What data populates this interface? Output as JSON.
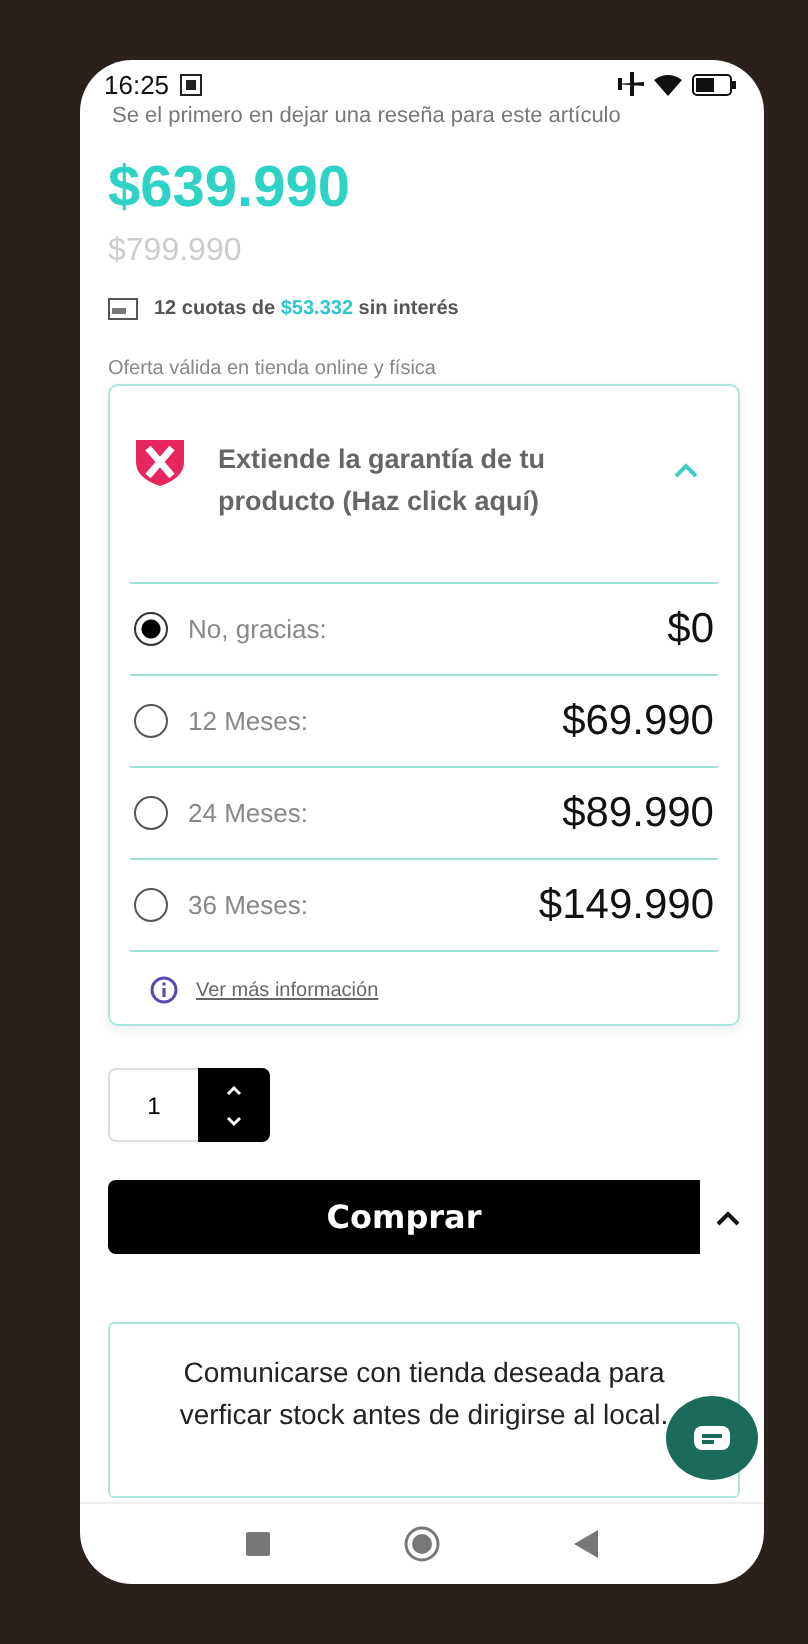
{
  "status_bar": {
    "time": "16:25"
  },
  "review_prompt": "Se el primero en dejar una reseña para este artículo",
  "price": "$639.990",
  "old_price": "$799.990",
  "installments": {
    "before": "12 cuotas de",
    "amount": "$53.332",
    "after": "sin interés"
  },
  "offer_note": "Oferta válida en tienda online y física",
  "warranty": {
    "title": "Extiende la garantía de tu producto (Haz click aquí)",
    "expanded": true,
    "options": [
      {
        "label": "No, gracias:",
        "price": "$0",
        "selected": true
      },
      {
        "label": "12 Meses:",
        "price": "$69.990",
        "selected": false
      },
      {
        "label": "24 Meses:",
        "price": "$89.990",
        "selected": false
      },
      {
        "label": "36 Meses:",
        "price": "$149.990",
        "selected": false
      }
    ],
    "info_link": "Ver más información"
  },
  "quantity": "1",
  "buy_button": "Comprar",
  "notice": "Comunicarse con tienda deseada para verficar stock antes de dirigirse al local."
}
